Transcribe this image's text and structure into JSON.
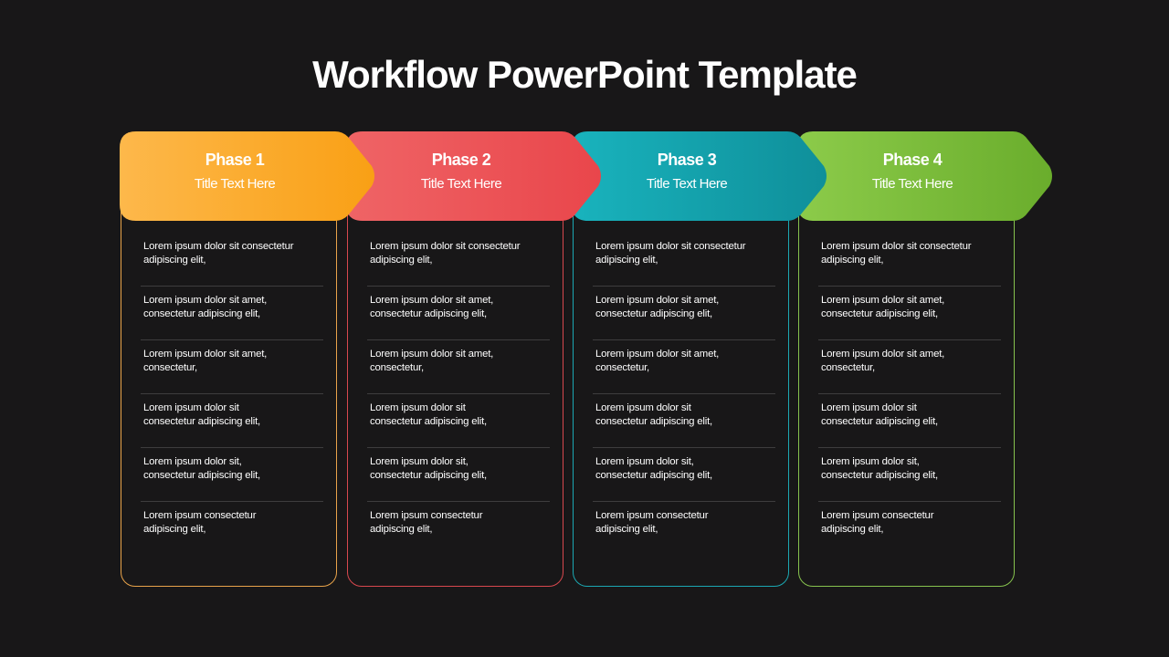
{
  "title": "Workflow PowerPoint Template",
  "phases": [
    {
      "label": "Phase 1",
      "subtitle": "Title Text Here",
      "color_start": "#fdb84b",
      "color_end": "#f9a015",
      "border": "#e8a34a",
      "items": [
        "Lorem ipsum dolor sit consectetur adipiscing elit,",
        "Lorem ipsum dolor sit amet, consectetur adipiscing elit,",
        "Lorem ipsum dolor sit amet, consectetur,",
        "Lorem ipsum dolor sit consectetur adipiscing elit,",
        "Lorem ipsum dolor sit, consectetur adipiscing elit,",
        "Lorem ipsum consectetur adipiscing elit,"
      ]
    },
    {
      "label": "Phase 2",
      "subtitle": "Title Text Here",
      "color_start": "#ef6466",
      "color_end": "#e9464b",
      "border": "#d8484e",
      "items": [
        "Lorem ipsum dolor sit consectetur adipiscing elit,",
        "Lorem ipsum dolor sit amet, consectetur adipiscing elit,",
        "Lorem ipsum dolor sit amet, consectetur,",
        "Lorem ipsum dolor sit consectetur adipiscing elit,",
        "Lorem ipsum dolor sit, consectetur adipiscing elit,",
        "Lorem ipsum consectetur adipiscing elit,"
      ]
    },
    {
      "label": "Phase 3",
      "subtitle": "Title Text Here",
      "color_start": "#19b3bd",
      "color_end": "#0f8f9a",
      "border": "#1ba8b2",
      "items": [
        "Lorem ipsum dolor sit consectetur adipiscing elit,",
        "Lorem ipsum dolor sit amet, consectetur adipiscing elit,",
        "Lorem ipsum dolor sit amet, consectetur,",
        "Lorem ipsum dolor sit consectetur adipiscing elit,",
        "Lorem ipsum dolor sit, consectetur adipiscing elit,",
        "Lorem ipsum consectetur adipiscing elit,"
      ]
    },
    {
      "label": "Phase 4",
      "subtitle": "Title Text Here",
      "color_start": "#8ccb4a",
      "color_end": "#6aad2c",
      "border": "#86c24e",
      "items": [
        "Lorem ipsum dolor sit consectetur adipiscing elit,",
        "Lorem ipsum dolor sit amet, consectetur adipiscing elit,",
        "Lorem ipsum dolor sit amet, consectetur,",
        "Lorem ipsum dolor sit consectetur adipiscing elit,",
        "Lorem ipsum dolor sit, consectetur adipiscing elit,",
        "Lorem ipsum consectetur adipiscing elit,"
      ]
    }
  ]
}
